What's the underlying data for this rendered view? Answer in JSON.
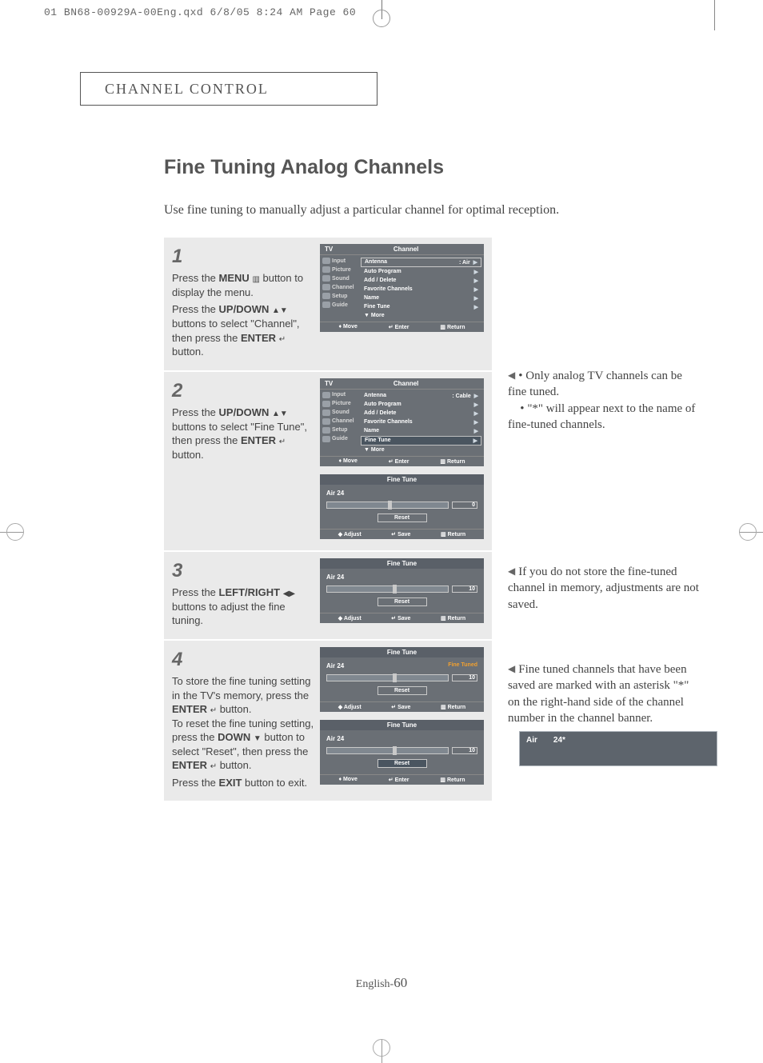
{
  "slug": "01 BN68-00929A-00Eng.qxd  6/8/05 8:24 AM  Page 60",
  "section_header": "CHANNEL CONTROL",
  "title": "Fine Tuning Analog Channels",
  "intro": "Use fine tuning to manually adjust a particular channel for optimal reception.",
  "steps": {
    "s1": {
      "num": "1",
      "p1a": "Press the ",
      "p1b": "MENU",
      "p1c": " button to display the menu.",
      "p2a": "Press the ",
      "p2b": "UP/DOWN",
      "p2c": " buttons to select \"Channel\", then press the ",
      "p2d": "ENTER",
      "p2e": " button."
    },
    "s2": {
      "num": "2",
      "p1a": "Press the ",
      "p1b": "UP/DOWN",
      "p1c": " buttons to select \"Fine Tune\", then press the ",
      "p1d": "ENTER",
      "p1e": " button."
    },
    "s3": {
      "num": "3",
      "p1a": "Press the ",
      "p1b": "LEFT/RIGHT",
      "p1c": " buttons to adjust the fine tuning."
    },
    "s4": {
      "num": "4",
      "p1a": "To store the fine tuning setting in the TV's memory, press the ",
      "p1b": "ENTER",
      "p1c": " button.",
      "p2a": "To reset the fine tuning setting, press the ",
      "p2b": "DOWN",
      "p2c": " button to select \"Reset\", then press  the ",
      "p2d": "ENTER",
      "p2e": " button.",
      "p3a": "Press the ",
      "p3b": "EXIT",
      "p3c": " button to exit."
    }
  },
  "osd": {
    "tv": "TV",
    "head": "Channel",
    "side": [
      "Input",
      "Picture",
      "Sound",
      "Channel",
      "Setup",
      "Guide"
    ],
    "items": [
      "Antenna",
      "Auto Program",
      "Add / Delete",
      "Favorite Channels",
      "Name",
      "Fine Tune"
    ],
    "more": "More",
    "val_air": ": Air",
    "val_cable": ": Cable",
    "foot_move": "Move",
    "foot_enter": "Enter",
    "foot_return": "Return"
  },
  "ft": {
    "title": "Fine Tune",
    "ch": "Air 24",
    "tuned": "Fine Tuned",
    "reset": "Reset",
    "v0": "0",
    "v10": "10",
    "foot_adjust": "Adjust",
    "foot_save": "Save",
    "foot_move": "Move",
    "foot_enter": "Enter",
    "foot_return": "Return"
  },
  "notes": {
    "n1a": "Only analog TV channels can be fine tuned.",
    "n1b": "\"*\" will appear next to the name  of fine-tuned channels.",
    "n2": "If you do not store the fine-tuned channel in memory, adjustments are not saved.",
    "n3": "Fine tuned channels that have been saved are marked with an asterisk \"*\" on the right-hand side of the channel number in the channel banner."
  },
  "banner": {
    "air": "Air",
    "ch": "24*"
  },
  "footer": {
    "lang": "English-",
    "page": "60"
  },
  "glyph": {
    "menu": "▥",
    "updown": "▲▼",
    "leftright": "◀▶",
    "enter": "↵",
    "down": "▼",
    "move_ud": "♦",
    "lr": "◆",
    "ent": "↵",
    "ret": "▥",
    "tri": "▶",
    "dtri": "▼"
  }
}
